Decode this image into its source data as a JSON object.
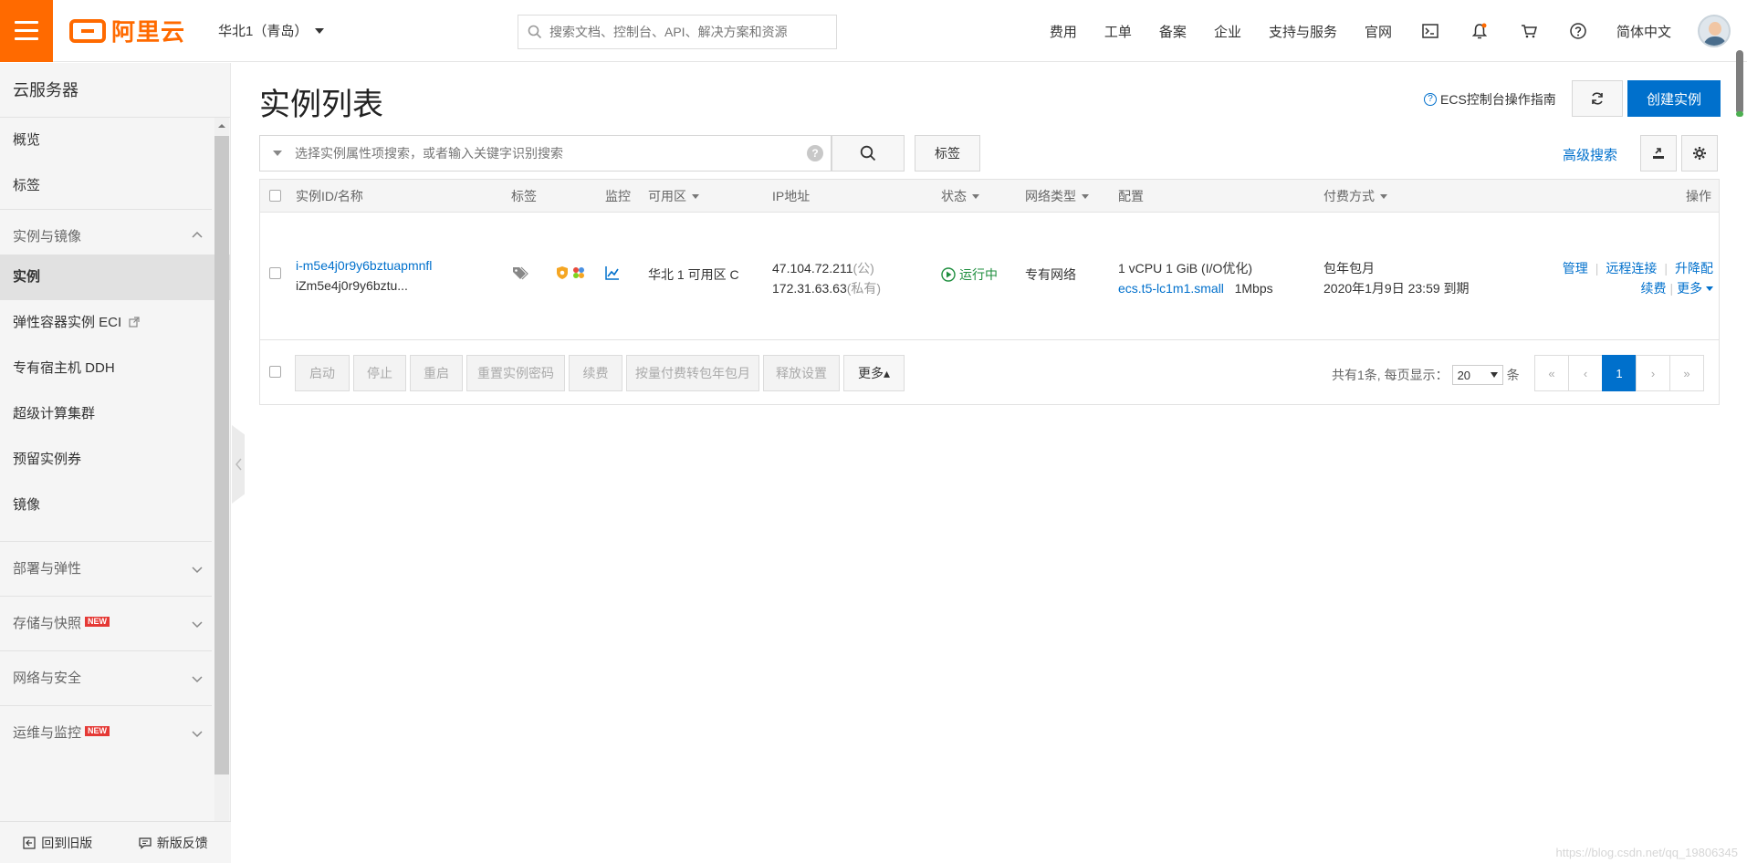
{
  "topbar": {
    "logo_text": "阿里云",
    "region": "华北1（青岛）",
    "search_placeholder": "搜索文档、控制台、API、解决方案和资源",
    "nav": [
      "费用",
      "工单",
      "备案",
      "企业",
      "支持与服务",
      "官网"
    ],
    "language": "简体中文",
    "icons": [
      "terminal-icon",
      "bell-icon",
      "cart-icon",
      "help-icon"
    ]
  },
  "sidebar": {
    "title": "云服务器",
    "top_items": [
      "概览",
      "标签"
    ],
    "group_instances": {
      "label": "实例与镜像",
      "items": [
        "实例",
        "弹性容器实例 ECI",
        "专有宿主机 DDH",
        "超级计算集群",
        "预留实例券",
        "镜像"
      ],
      "active": "实例"
    },
    "groups": [
      {
        "label": "部署与弹性",
        "new": ""
      },
      {
        "label": "存储与快照",
        "new": "NEW"
      },
      {
        "label": "网络与安全",
        "new": ""
      },
      {
        "label": "运维与监控",
        "new": "NEW"
      }
    ],
    "bottom": {
      "back_label": "回到旧版",
      "feedback_label": "新版反馈"
    }
  },
  "main": {
    "page_title": "实例列表",
    "guide_link": "ECS控制台操作指南",
    "create_button": "创建实例",
    "filter_placeholder": "选择实例属性项搜索，或者输入关键字识别搜索",
    "tag_button": "标签",
    "advanced_search": "高级搜索",
    "columns": {
      "id_name": "实例ID/名称",
      "tags": "标签",
      "monitor": "监控",
      "zone": "可用区",
      "ip": "IP地址",
      "status": "状态",
      "network": "网络类型",
      "config": "配置",
      "billing": "付费方式",
      "actions": "操作"
    },
    "row": {
      "instance_id": "i-m5e4j0r9y6bztuapmnfl",
      "instance_name": "iZm5e4j0r9y6bztu...",
      "zone": "华北 1 可用区 C",
      "public_ip": "47.104.72.211",
      "public_suffix": "(公)",
      "private_ip": "172.31.63.63",
      "private_suffix": "(私有)",
      "status": "运行中",
      "network": "专有网络",
      "config_line1": "1 vCPU 1 GiB (I/O优化)",
      "instance_type": "ecs.t5-lc1m1.small",
      "bandwidth": "1Mbps",
      "billing_type": "包年包月",
      "expiry": "2020年1月9日 23:59 到期",
      "actions": {
        "manage": "管理",
        "remote": "远程连接",
        "upgrade": "升降配",
        "renew": "续费",
        "more": "更多"
      }
    },
    "footer_buttons": [
      "启动",
      "停止",
      "重启",
      "重置实例密码",
      "续费",
      "按量付费转包年包月",
      "释放设置",
      "更多▴"
    ],
    "pager": {
      "total_text": "共有1条, 每页显示：",
      "page_size": "20",
      "unit": "条",
      "first": "«",
      "prev": "‹",
      "current": "1",
      "next": "›",
      "last": "»"
    }
  },
  "watermark": "https://blog.csdn.net/qq_19806345",
  "colors": {
    "brand": "#ff6a00",
    "primary": "#0070cc",
    "running": "#1e8e3e"
  }
}
